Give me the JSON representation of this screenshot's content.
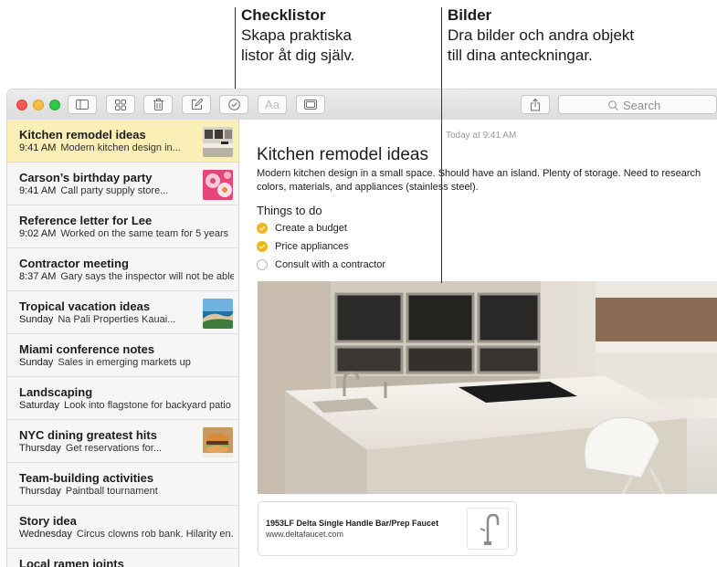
{
  "callouts": {
    "checklists": {
      "title": "Checklistor",
      "line1": "Skapa praktiska",
      "line2": "listor åt dig själv."
    },
    "images": {
      "title": "Bilder",
      "line1": "Dra bilder och andra objekt",
      "line2": "till dina anteckningar."
    }
  },
  "toolbar": {
    "format_label": "Aa",
    "search_placeholder": "Search"
  },
  "notes": [
    {
      "title": "Kitchen remodel ideas",
      "time": "9:41 AM",
      "preview": "Modern kitchen design in...",
      "thumb": "kitchen"
    },
    {
      "title": "Carson’s birthday party",
      "time": "9:41 AM",
      "preview": "Call party supply store...",
      "thumb": "cupcakes"
    },
    {
      "title": "Reference letter for Lee",
      "time": "9:02 AM",
      "preview": "Worked on the same team for 5 years"
    },
    {
      "title": "Contractor meeting",
      "time": "8:37 AM",
      "preview": "Gary says the inspector will not be able..."
    },
    {
      "title": "Tropical vacation ideas",
      "time": "Sunday",
      "preview": "Na Pali Properties Kauai...",
      "thumb": "coast"
    },
    {
      "title": "Miami conference notes",
      "time": "Sunday",
      "preview": "Sales in emerging markets up"
    },
    {
      "title": "Landscaping",
      "time": "Saturday",
      "preview": "Look into flagstone for backyard patio"
    },
    {
      "title": "NYC dining greatest hits",
      "time": "Thursday",
      "preview": "Get reservations for...",
      "thumb": "burger"
    },
    {
      "title": "Team-building activities",
      "time": "Thursday",
      "preview": "Paintball tournament"
    },
    {
      "title": "Story idea",
      "time": "Wednesday",
      "preview": "Circus clowns rob bank. Hilarity en..."
    },
    {
      "title": "Local ramen joints",
      "time": "",
      "preview": ""
    }
  ],
  "note": {
    "date": "Today at 9:41 AM",
    "title": "Kitchen remodel ideas",
    "body": "Modern kitchen design in a small space. Should have an island. Plenty of storage. Need to research colors, materials, and appliances (stainless steel).",
    "checklist_heading": "Things to do",
    "checklist": [
      {
        "text": "Create a budget",
        "done": true
      },
      {
        "text": "Price appliances",
        "done": true
      },
      {
        "text": "Consult with a contractor",
        "done": false
      }
    ],
    "link_card": {
      "title": "1953LF Delta Single Handle Bar/Prep Faucet",
      "url": "www.deltafaucet.com"
    }
  },
  "colors": {
    "accent": "#f4b51c",
    "selected_note": "#faefb7"
  }
}
